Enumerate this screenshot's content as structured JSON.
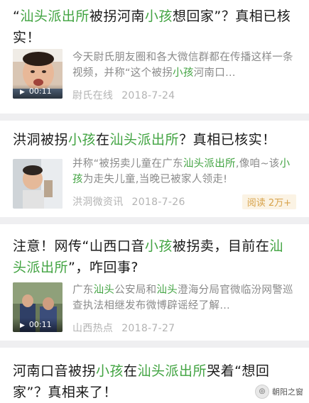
{
  "articles": [
    {
      "title": [
        {
          "t": "“",
          "h": false
        },
        {
          "t": "汕头派出所",
          "h": true
        },
        {
          "t": "被拐河南",
          "h": false
        },
        {
          "t": "小孩",
          "h": true
        },
        {
          "t": "想回家”？真相已核实！",
          "h": false
        }
      ],
      "desc": [
        {
          "t": "今天尉氏朋友圈和各大微信群都在传播这样一条视频，并称“这个被拐",
          "h": false
        },
        {
          "t": "小孩",
          "h": true
        },
        {
          "t": "河南口…",
          "h": false
        }
      ],
      "source": "尉氏在线",
      "date": "2018-7-24",
      "duration": "00:11",
      "thumb_icon": "crying-child-thumbnail"
    },
    {
      "title": [
        {
          "t": "洪洞被拐",
          "h": false
        },
        {
          "t": "小孩",
          "h": true
        },
        {
          "t": "在",
          "h": false
        },
        {
          "t": "汕头派出所",
          "h": true
        },
        {
          "t": "？真相已核实！",
          "h": false
        }
      ],
      "desc": [
        {
          "t": "并称“被拐卖儿童在广东",
          "h": false
        },
        {
          "t": "汕头派出所",
          "h": true
        },
        {
          "t": ",像咱~该",
          "h": false
        },
        {
          "t": "小孩",
          "h": true
        },
        {
          "t": "为走失儿童,当晚已被家人领走!",
          "h": false
        }
      ],
      "source": "洪洞微资讯",
      "date": "2018-7-26",
      "badge": "阅读 2万+",
      "thumb_icon": "child-photo-thumbnail"
    },
    {
      "title": [
        {
          "t": "注意！网传“山西口音",
          "h": false
        },
        {
          "t": "小孩",
          "h": true
        },
        {
          "t": "被拐卖，目前在",
          "h": false
        },
        {
          "t": "汕头派出所",
          "h": true
        },
        {
          "t": "”，咋回事?",
          "h": false
        }
      ],
      "desc": [
        {
          "t": "广东",
          "h": false
        },
        {
          "t": "汕头",
          "h": true
        },
        {
          "t": "公安局和",
          "h": false
        },
        {
          "t": "汕头",
          "h": true
        },
        {
          "t": "澄海分局官微临汾网警巡查执法相继发布微博辟谣经了解…",
          "h": false
        }
      ],
      "source": "山西热点",
      "date": "2018-7-27",
      "duration": "00:11",
      "thumb_icon": "police-video-thumbnail"
    },
    {
      "title": [
        {
          "t": "河南口音被拐",
          "h": false
        },
        {
          "t": "小孩",
          "h": true
        },
        {
          "t": "在",
          "h": false
        },
        {
          "t": "汕头派出所",
          "h": true
        },
        {
          "t": "哭着“想回家”？真相来了！",
          "h": false
        }
      ]
    }
  ],
  "watermark": "朝阳之窗",
  "colors": {
    "highlight": "#41a341",
    "background": "#efeff1",
    "badge_text": "#d7a24a"
  }
}
